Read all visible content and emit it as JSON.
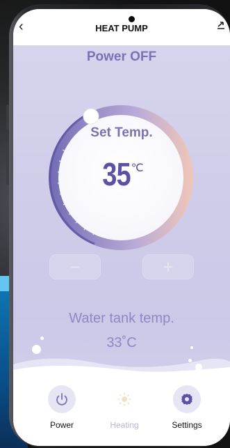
{
  "header": {
    "back_icon": "chevron-left-icon",
    "title": "HEAT PUMP",
    "logout_icon": "logout-icon"
  },
  "status": {
    "power_text": "Power OFF"
  },
  "thermostat": {
    "set_label": "Set Temp.",
    "value": "35",
    "unit": "℃",
    "minus_label": "−",
    "plus_label": "+"
  },
  "water_tank": {
    "label": "Water tank temp.",
    "value": "33˚C"
  },
  "bottom_nav": {
    "items": [
      {
        "label": "Power",
        "icon": "power-icon",
        "enabled": true
      },
      {
        "label": "Heating",
        "icon": "sun-icon",
        "enabled": false
      },
      {
        "label": "Settings",
        "icon": "gear-icon",
        "enabled": true
      }
    ]
  },
  "colors": {
    "accent": "#7b72b5",
    "temp_text": "#5c52a4",
    "muted_text": "#8e88c4",
    "disabled_label": "#b9b7cc"
  }
}
